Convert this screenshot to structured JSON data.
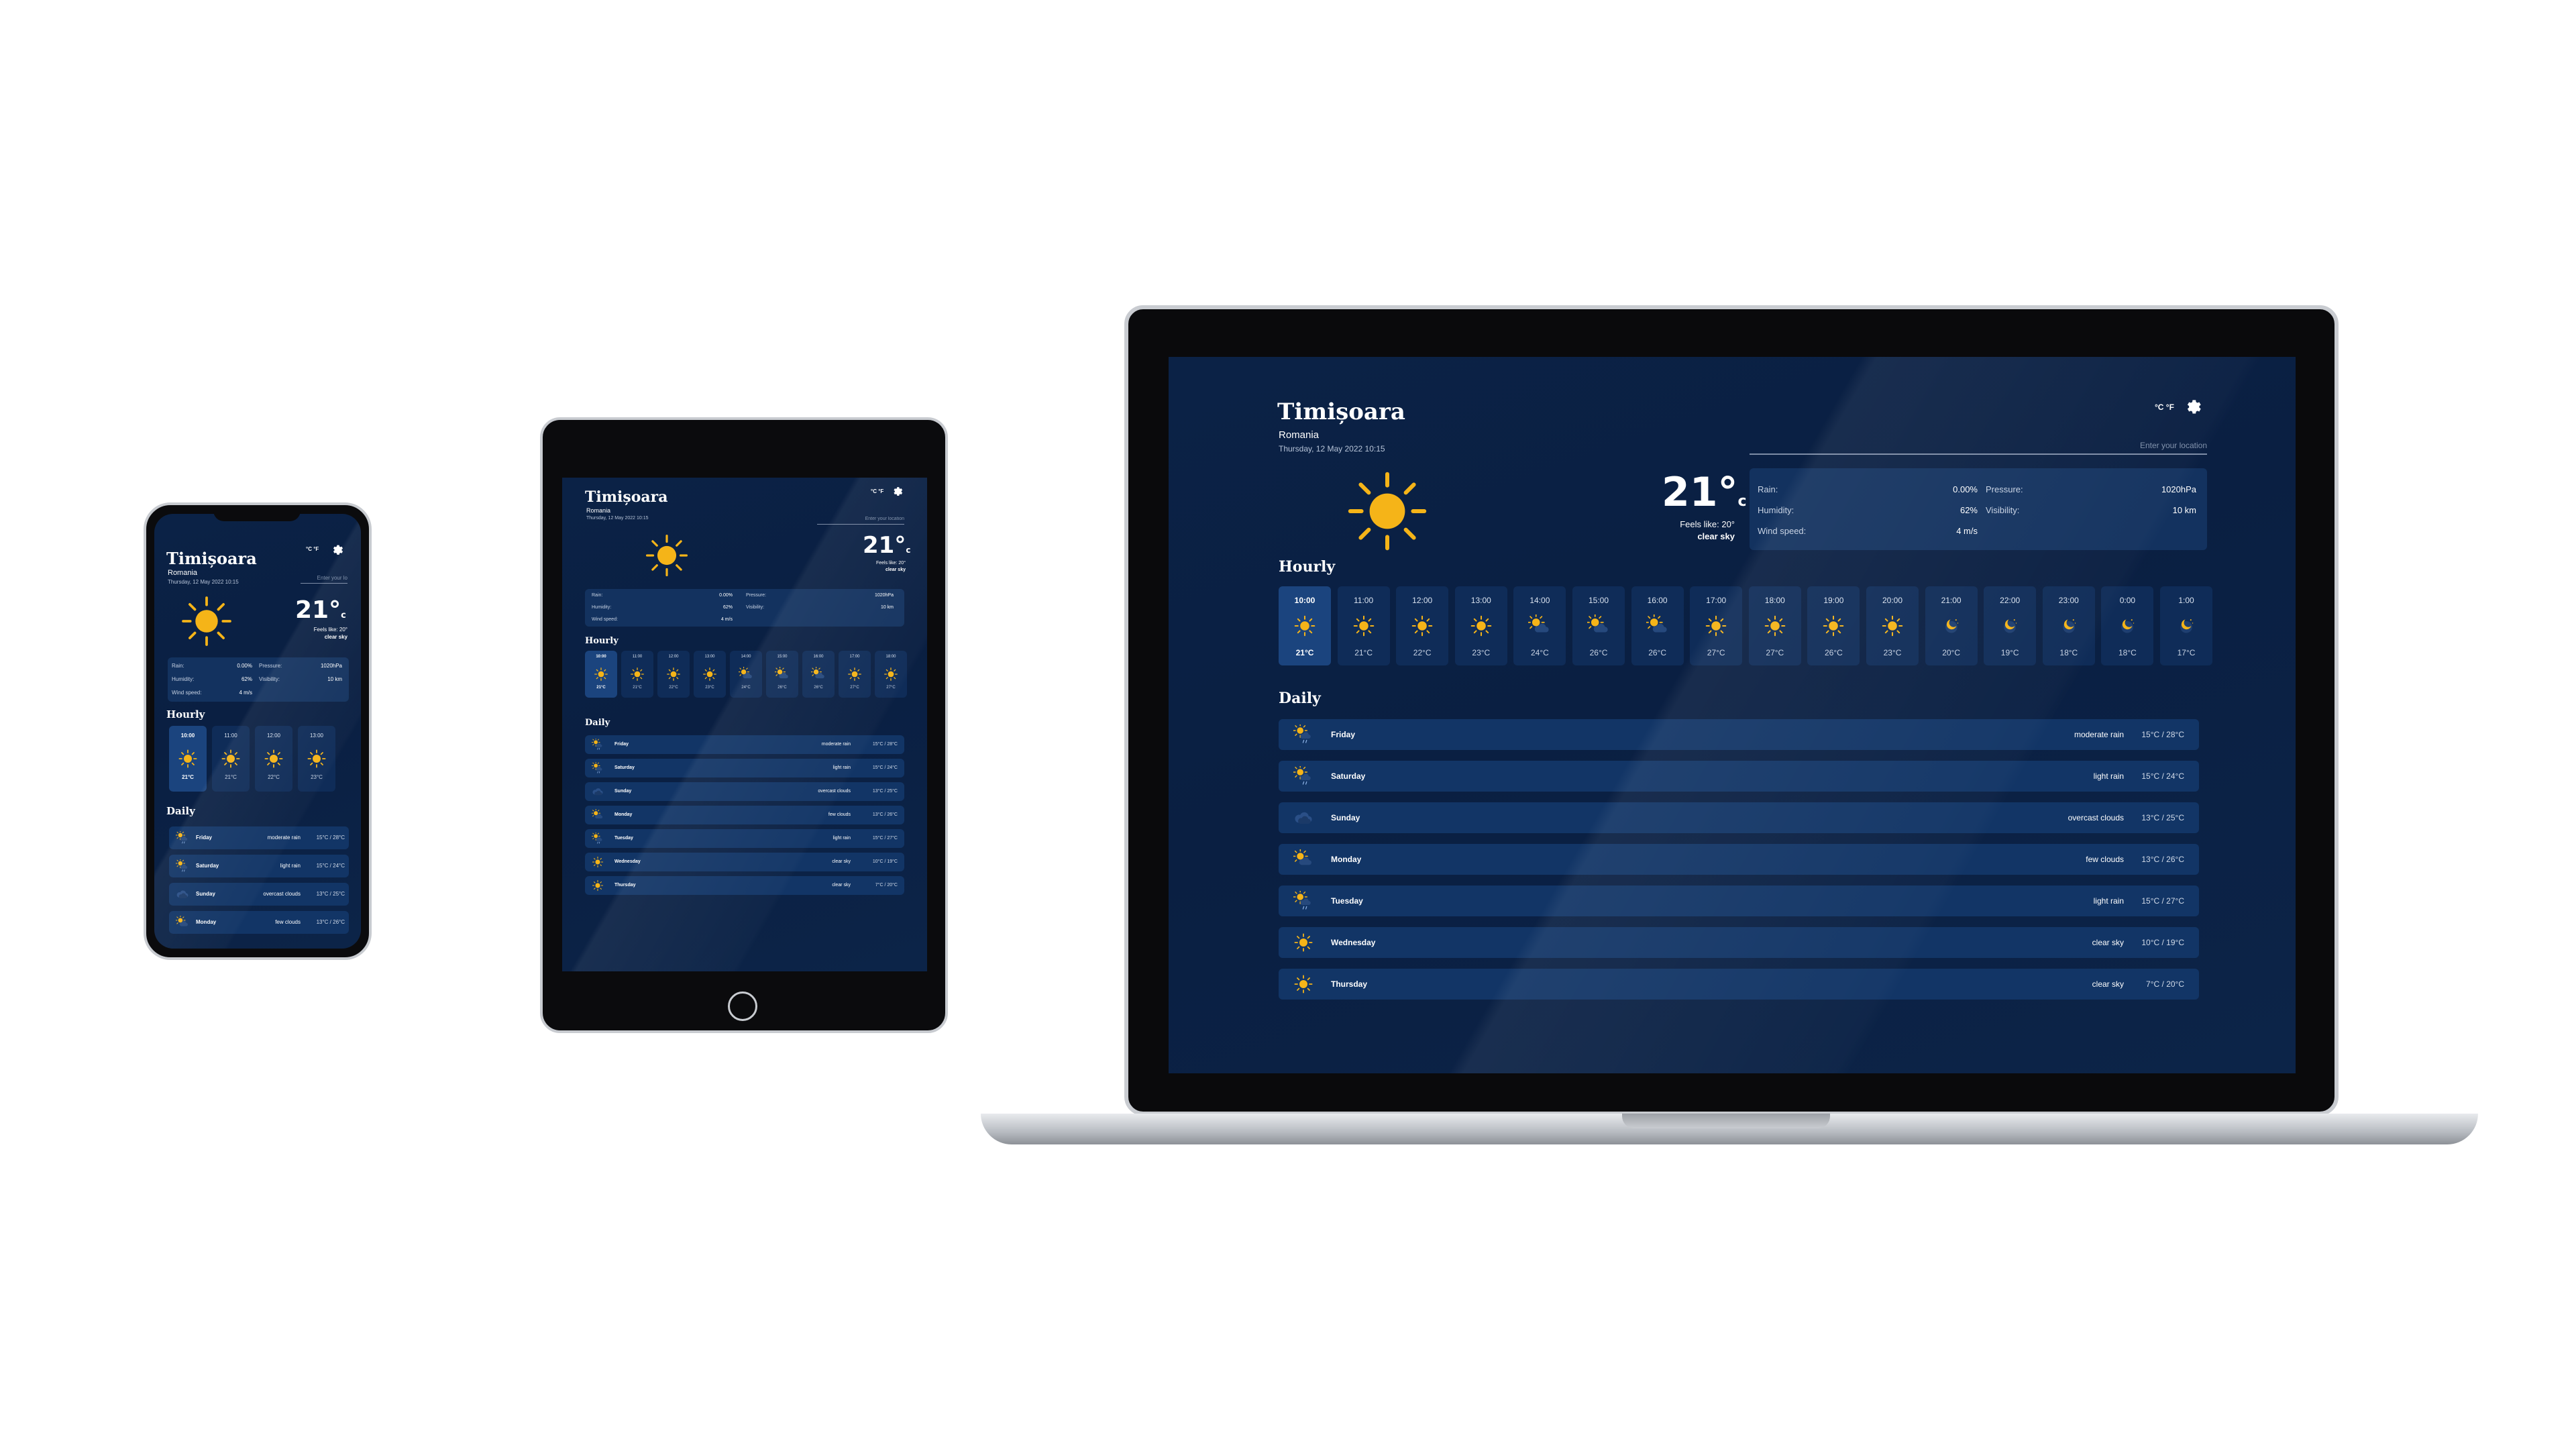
{
  "app": {
    "city": "Timișoara",
    "country": "Romania",
    "date": "Thursday, 12 May 2022 10:15",
    "units": "°C °F",
    "search_placeholder": "Enter your location",
    "temp": "21°",
    "temp_unit": "c",
    "feels_label": "Feels like: 20°",
    "condition": "clear sky",
    "stats": {
      "rain_label": "Rain:",
      "rain_value": "0.00%",
      "humidity_label": "Humidity:",
      "humidity_value": "62%",
      "wind_label": "Wind speed:",
      "wind_value": "4 m/s",
      "pressure_label": "Pressure:",
      "pressure_value": "1020hPa",
      "visibility_label": "Visibility:",
      "visibility_value": "10 km"
    },
    "hourly_title": "Hourly",
    "daily_title": "Daily",
    "hourly": [
      {
        "time": "10:00",
        "temp": "21°C",
        "icon": "sun-icon"
      },
      {
        "time": "11:00",
        "temp": "21°C",
        "icon": "sun-icon"
      },
      {
        "time": "12:00",
        "temp": "22°C",
        "icon": "sun-icon"
      },
      {
        "time": "13:00",
        "temp": "23°C",
        "icon": "sun-icon"
      },
      {
        "time": "14:00",
        "temp": "24°C",
        "icon": "partly-cloudy-icon"
      },
      {
        "time": "15:00",
        "temp": "26°C",
        "icon": "partly-cloudy-icon"
      },
      {
        "time": "16:00",
        "temp": "26°C",
        "icon": "partly-cloudy-icon"
      },
      {
        "time": "17:00",
        "temp": "27°C",
        "icon": "sun-icon"
      },
      {
        "time": "18:00",
        "temp": "27°C",
        "icon": "sun-icon"
      },
      {
        "time": "19:00",
        "temp": "26°C",
        "icon": "sun-icon"
      },
      {
        "time": "20:00",
        "temp": "23°C",
        "icon": "sun-icon"
      },
      {
        "time": "21:00",
        "temp": "20°C",
        "icon": "moon-icon"
      },
      {
        "time": "22:00",
        "temp": "19°C",
        "icon": "moon-icon"
      },
      {
        "time": "23:00",
        "temp": "18°C",
        "icon": "moon-icon"
      },
      {
        "time": "0:00",
        "temp": "18°C",
        "icon": "moon-icon"
      },
      {
        "time": "1:00",
        "temp": "17°C",
        "icon": "moon-icon"
      }
    ],
    "daily": [
      {
        "day": "Friday",
        "desc": "moderate rain",
        "range": "15°C / 28°C",
        "icon": "rain-sun-icon"
      },
      {
        "day": "Saturday",
        "desc": "light rain",
        "range": "15°C / 24°C",
        "icon": "rain-sun-icon"
      },
      {
        "day": "Sunday",
        "desc": "overcast clouds",
        "range": "13°C / 25°C",
        "icon": "cloud-icon"
      },
      {
        "day": "Monday",
        "desc": "few clouds",
        "range": "13°C / 26°C",
        "icon": "partly-cloudy-icon"
      },
      {
        "day": "Tuesday",
        "desc": "light rain",
        "range": "15°C / 27°C",
        "icon": "rain-sun-icon"
      },
      {
        "day": "Wednesday",
        "desc": "clear sky",
        "range": "10°C / 19°C",
        "icon": "sun-icon"
      },
      {
        "day": "Thursday",
        "desc": "clear sky",
        "range": "7°C / 20°C",
        "icon": "sun-icon"
      }
    ]
  },
  "phone": {
    "search_placeholder": "Enter your lo",
    "daily": [
      {
        "day": "Friday",
        "desc_1": "moderate",
        "desc_2": "rain",
        "range": "15°C / 28°C"
      },
      {
        "day": "Saturday",
        "desc_1": "light rain",
        "desc_2": "",
        "range": "15°C / 24°C"
      },
      {
        "day": "Sunday",
        "desc_1": "overcast",
        "desc_2": "clouds",
        "range": "13°C / 25°C"
      },
      {
        "day": "Monday",
        "desc_1": "few clouds",
        "desc_2": "",
        "range": "13°C / 26°C"
      }
    ]
  },
  "colors": {
    "accent_sun": "#f5b418",
    "bg": "#0b2246",
    "card": "#123566"
  }
}
